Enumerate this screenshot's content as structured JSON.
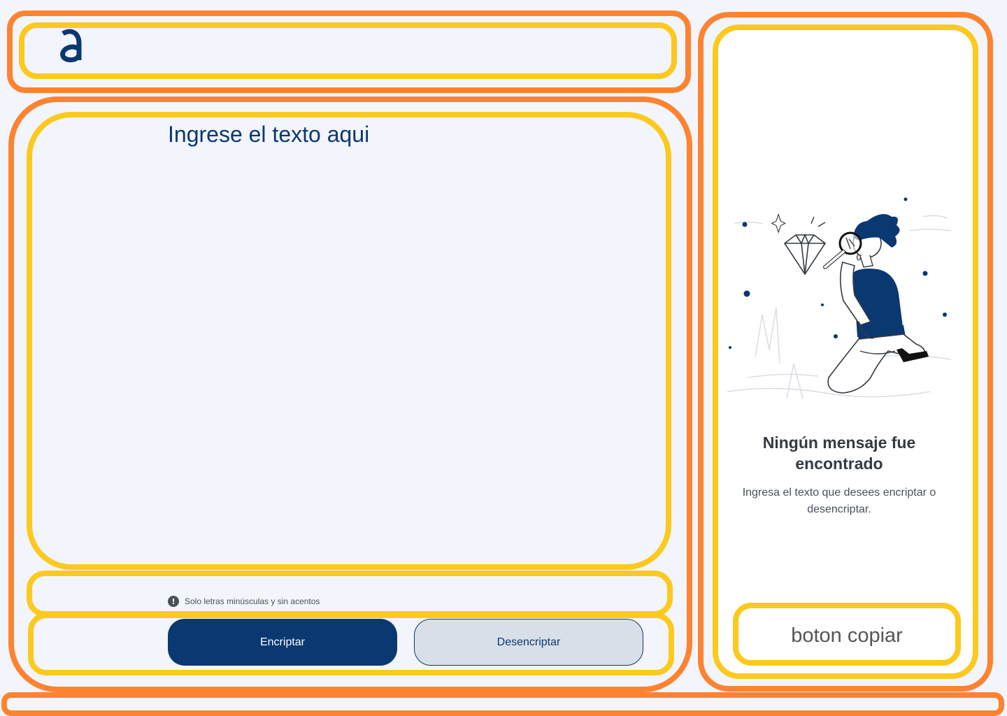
{
  "input": {
    "placeholder": "Ingrese el texto aqui"
  },
  "hint": {
    "icon": "info-icon",
    "text": "Solo letras minúsculas y sin acentos"
  },
  "buttons": {
    "encrypt_label": "Encriptar",
    "decrypt_label": "Desencriptar"
  },
  "result_panel": {
    "illustration": "person-with-magnifying-glass-illustration",
    "title": "Ningún mensaje fue encontrado",
    "description": "Ingresa el texto que desees encriptar o desencriptar.",
    "copy_label": "boton copiar"
  },
  "colors": {
    "primary": "#0a3871",
    "outline_orange": "#fe8330",
    "outline_yellow": "#fcc91e",
    "background": "#f3f5fc",
    "secondary_button": "#d8dfe8"
  }
}
